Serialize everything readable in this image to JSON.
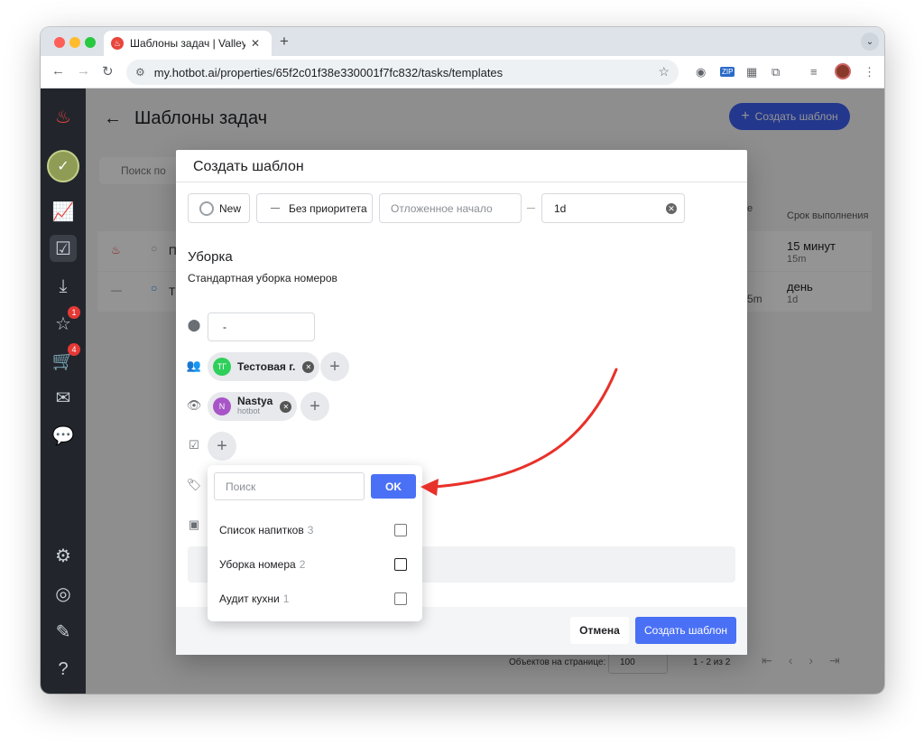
{
  "browser": {
    "tab_title": "Шаблоны задач | Valley Hotel",
    "url": "my.hotbot.ai/properties/65f2c01f38e330001f7fc832/tasks/templates"
  },
  "sidebar": {
    "badges": {
      "reviews": "1",
      "orders": "4"
    }
  },
  "page": {
    "title": "Шаблоны задач",
    "create_button": "Создать шаблон",
    "search_placeholder": "Поиск по",
    "column_due": "Срок выполнения",
    "column_partial": "е",
    "rows": [
      {
        "name_initial": "П",
        "due": "15 минут",
        "due_sub": "15m",
        "extra": ""
      },
      {
        "name_initial": "Т",
        "due": "день",
        "due_sub": "1d",
        "extra": "5m"
      }
    ],
    "pager": {
      "per_page_label": "Объектов на странице:",
      "per_page": "100",
      "range": "1 - 2 из 2"
    }
  },
  "modal": {
    "title": "Создать шаблон",
    "status": "New",
    "priority": "Без приоритета",
    "delayed_start_placeholder": "Отложенное начало",
    "duration": "1d",
    "task_title": "Уборка",
    "task_description": "Стандартная уборка номеров",
    "location": "-",
    "assignee": {
      "initials": "ТГ",
      "name": "Тестовая г."
    },
    "watcher": {
      "initials": "N",
      "name": "Nastya",
      "sub": "hotbot"
    },
    "cancel": "Отмена",
    "submit": "Создать шаблон"
  },
  "tag_dropdown": {
    "search_placeholder": "Поиск",
    "ok": "OK",
    "items": [
      {
        "label": "Список напитков",
        "count": "3"
      },
      {
        "label": "Уборка номера",
        "count": "2"
      },
      {
        "label": "Аудит кухни",
        "count": "1"
      }
    ]
  },
  "colors": {
    "primary": "#4a70f5",
    "annotation_arrow": "#e8312a",
    "sidebar": "#22262c"
  }
}
